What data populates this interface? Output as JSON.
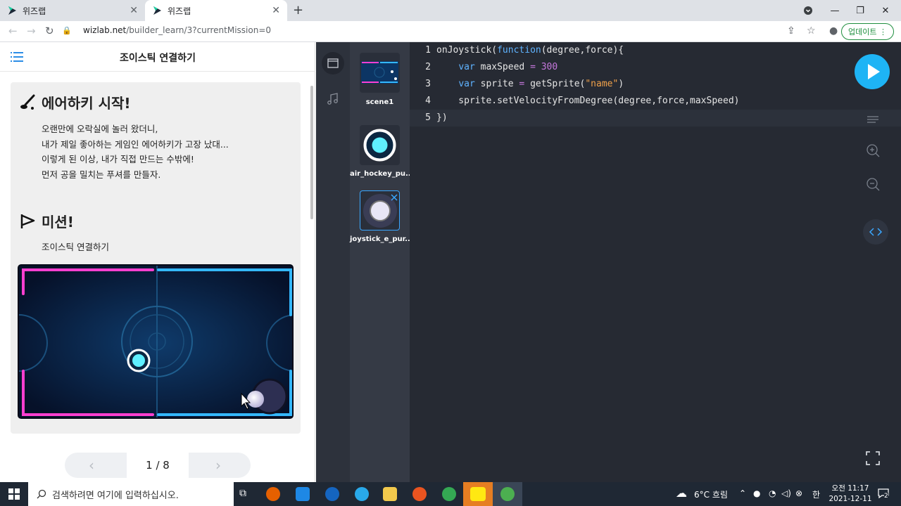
{
  "browser": {
    "tabs": [
      {
        "label": "위즈랩"
      },
      {
        "label": "위즈랩"
      }
    ],
    "url_domain": "wizlab.net",
    "url_path": "/builder_learn/3?currentMission=0",
    "update_label": "업데이트"
  },
  "lesson": {
    "title": "조이스틱 연결하기",
    "section1_heading": "에어하키 시작!",
    "section1_lines": [
      "오랜만에 오락실에 놀러 왔더니,",
      "내가 제일 좋아하는 게임인 에어하키가 고장 났대...",
      "이렇게 된 이상, 내가 직접 만드는 수밖에!",
      "먼저 공을 밀치는 푸셔를 만들자."
    ],
    "section2_heading": "미션!",
    "section2_text": "조이스틱 연결하기",
    "page_indicator": "1 / 8"
  },
  "assets": [
    {
      "label": "scene1"
    },
    {
      "label": "air_hockey_pu..."
    },
    {
      "label": "joystick_e_pur..."
    }
  ],
  "code": {
    "line_numbers": [
      "1",
      "2",
      "3",
      "4",
      "5"
    ],
    "lines": [
      {
        "a": "onJoystick",
        "b": "(",
        "c": "function",
        "d": "(degree,force){"
      },
      {
        "a": "    ",
        "kw": "var",
        "b": " maxSpeed ",
        "op": "=",
        "num": " 300"
      },
      {
        "a": "    ",
        "kw": "var",
        "b": " sprite ",
        "op": "=",
        "c": " getSprite(",
        "str": "\"name\"",
        "d": ")"
      },
      {
        "a": "    sprite.setVelocityFromDegree(degree,force,maxSpeed)"
      },
      {
        "a": "})"
      }
    ]
  },
  "taskbar": {
    "search_placeholder": "검색하려면 여기에 입력하십시오.",
    "weather": "6°C  흐림",
    "ime": "한",
    "time": "오전 11:17",
    "date": "2021-12-11",
    "notification_count": "2"
  },
  "colors": {
    "accent": "#1eb4f5",
    "editor_bg": "#262a33",
    "pink": "#ff3fd0",
    "cyan": "#34b8ff"
  }
}
